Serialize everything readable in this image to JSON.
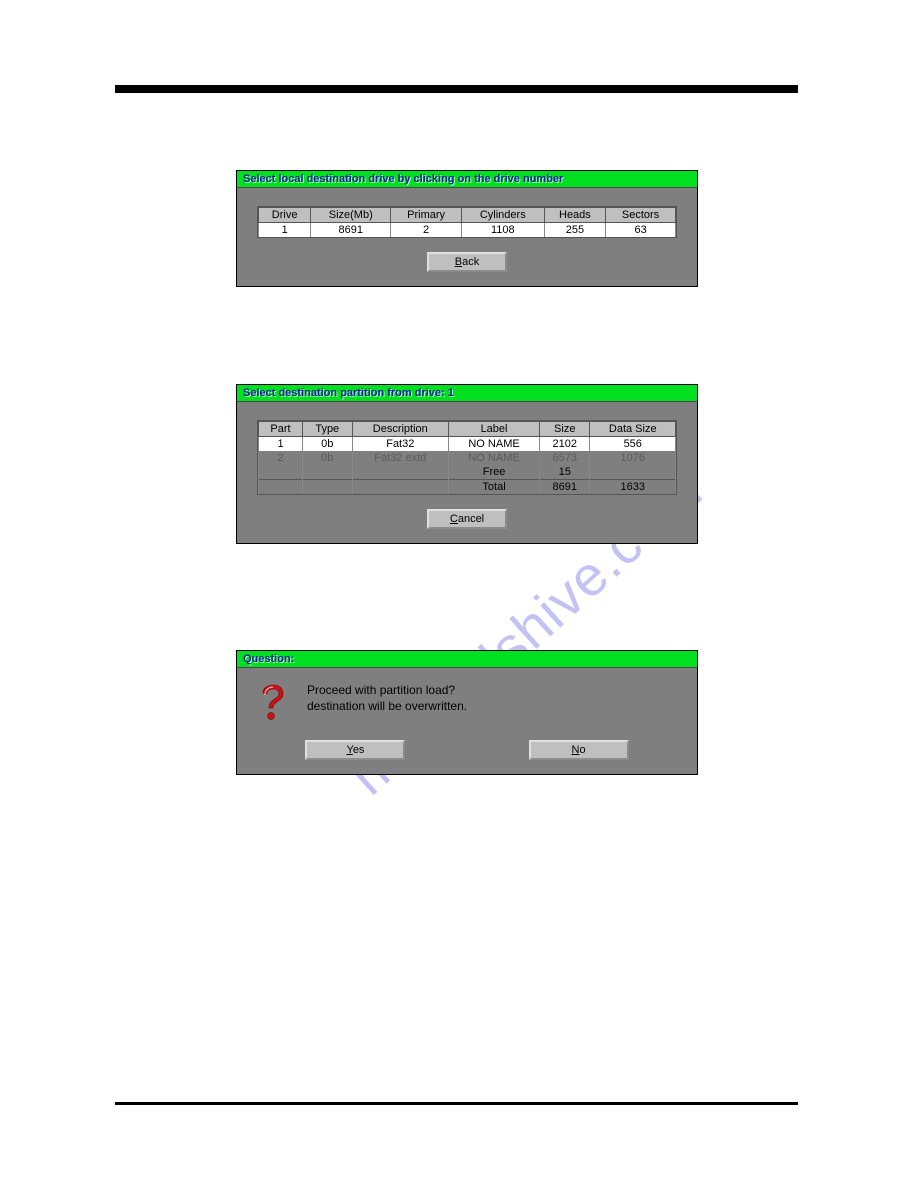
{
  "watermark": "manualshive.com",
  "dialog1": {
    "title": "Select local destination drive by clicking on the drive number",
    "headers": [
      "Drive",
      "Size(Mb)",
      "Primary",
      "Cylinders",
      "Heads",
      "Sectors"
    ],
    "row": [
      "1",
      "8691",
      "2",
      "1108",
      "255",
      "63"
    ],
    "back_label": "Back"
  },
  "dialog2": {
    "title": "Select destination partition from drive: 1",
    "headers": [
      "Part",
      "Type",
      "Description",
      "Label",
      "Size",
      "Data Size"
    ],
    "rows": [
      {
        "cells": [
          "1",
          "0b",
          "Fat32",
          "NO NAME",
          "2102",
          "556"
        ],
        "kind": "sel"
      },
      {
        "cells": [
          "2",
          "0b",
          "Fat32 extd",
          "NO NAME",
          "6573",
          "1076"
        ],
        "kind": "dim"
      },
      {
        "cells": [
          "",
          "",
          "",
          "Free",
          "15",
          ""
        ],
        "kind": "norm"
      },
      {
        "cells": [
          "",
          "",
          "",
          "Total",
          "8691",
          "1633"
        ],
        "kind": "norm"
      }
    ],
    "cancel_label": "Cancel"
  },
  "dialog3": {
    "title": "Question:",
    "line1": "Proceed with partition load?",
    "line2": "destination will be overwritten.",
    "yes_label": "Yes",
    "no_label": "No"
  }
}
